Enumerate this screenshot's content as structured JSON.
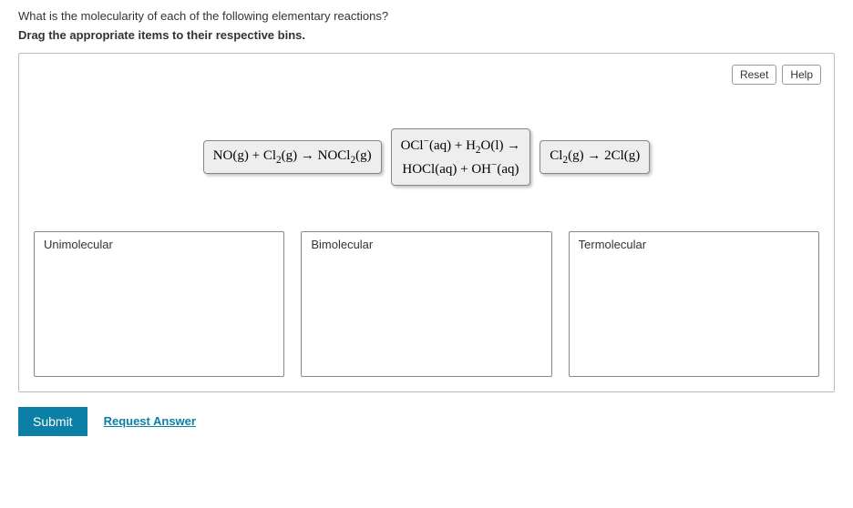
{
  "question": "What is the molecularity of each of the following elementary reactions?",
  "instruction": "Drag the appropriate items to their respective bins.",
  "buttons": {
    "reset": "Reset",
    "help": "Help",
    "submit": "Submit",
    "request_answer": "Request Answer"
  },
  "items": [
    {
      "html": "NO(g) + Cl<sub>2</sub>(g) → NOCl<sub>2</sub>(g)"
    },
    {
      "html": "OCl<sup>−</sup>(aq) + H<sub>2</sub>O(l) →<br>HOCl(aq) + OH<sup>−</sup>(aq)"
    },
    {
      "html": "Cl<sub>2</sub>(g) → 2Cl(g)"
    }
  ],
  "bins": [
    {
      "label": "Unimolecular"
    },
    {
      "label": "Bimolecular"
    },
    {
      "label": "Termolecular"
    }
  ]
}
